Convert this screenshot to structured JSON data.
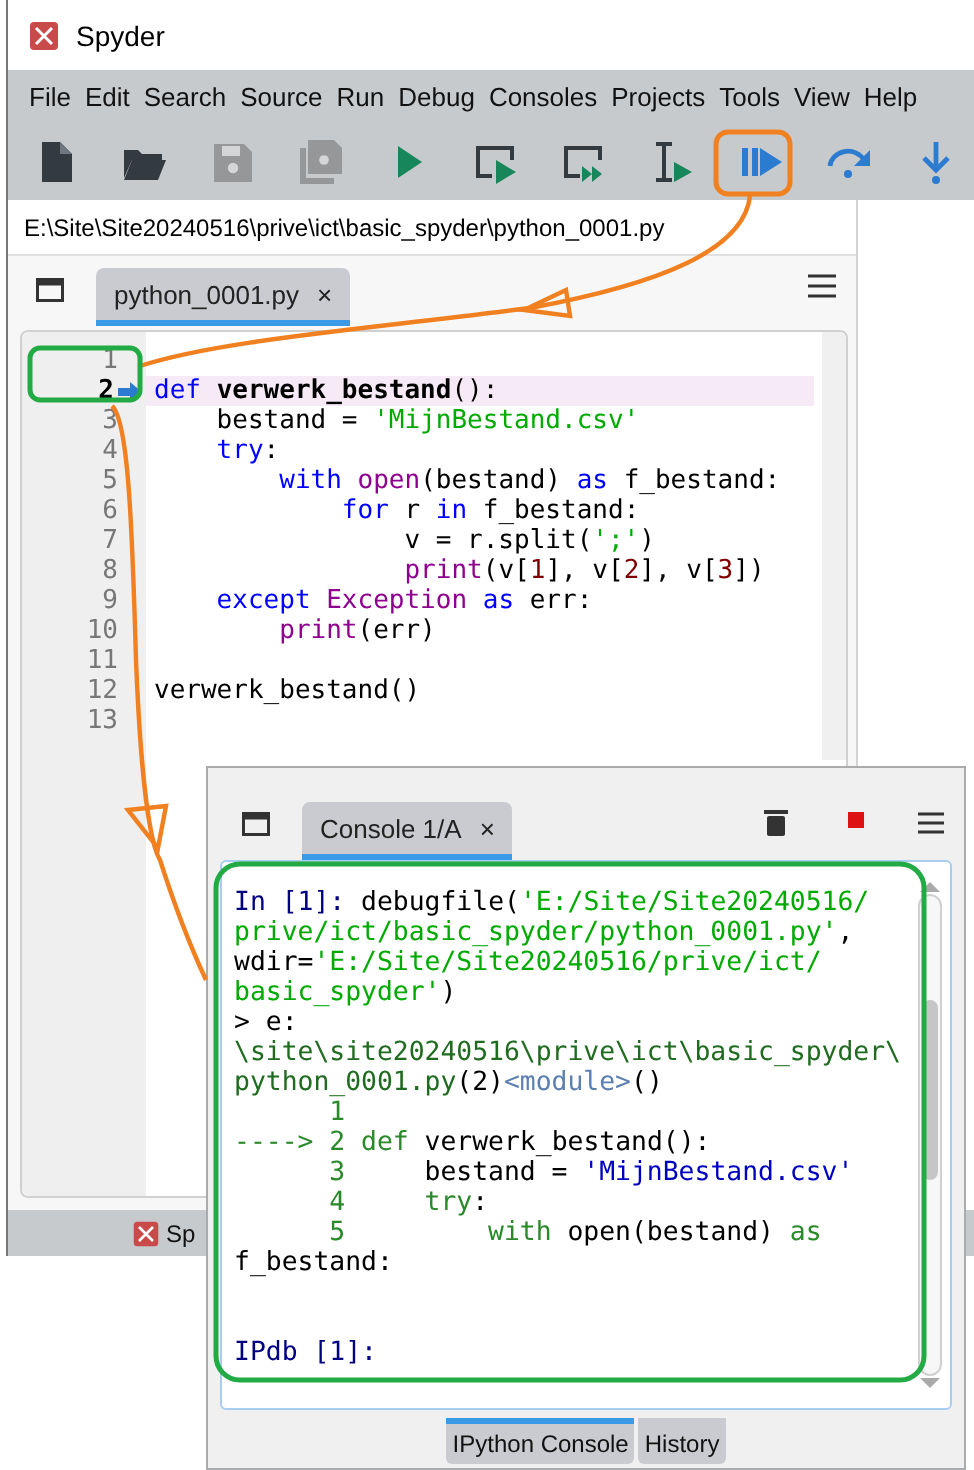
{
  "window": {
    "title": "Spyder"
  },
  "menu": [
    "File",
    "Edit",
    "Search",
    "Source",
    "Run",
    "Debug",
    "Consoles",
    "Projects",
    "Tools",
    "View",
    "Help"
  ],
  "toolbar": [
    {
      "kind": "new-file",
      "disabled": false
    },
    {
      "kind": "open",
      "disabled": false
    },
    {
      "kind": "save",
      "disabled": true
    },
    {
      "kind": "save-all",
      "disabled": true
    },
    {
      "kind": "run",
      "disabled": false
    },
    {
      "kind": "run-cell",
      "disabled": false
    },
    {
      "kind": "run-cell-advance",
      "disabled": false
    },
    {
      "kind": "run-selection",
      "disabled": false
    },
    {
      "kind": "debug",
      "disabled": false
    },
    {
      "kind": "step-over",
      "disabled": false
    },
    {
      "kind": "step-into",
      "disabled": false
    }
  ],
  "path": "E:\\Site\\Site20240516\\prive\\ict\\basic_spyder\\python_0001.py",
  "editor": {
    "tabs": [
      {
        "label": "python_0001.py",
        "close": "×",
        "selected": true
      }
    ],
    "lines": [
      {
        "number": "1",
        "current": false
      },
      {
        "number": "2",
        "current": true,
        "tokens": [
          {
            "kind": "keyword",
            "text": "def "
          },
          {
            "kind": "defname",
            "text": "verwerk_bestand"
          },
          {
            "kind": "plain",
            "text": "():"
          }
        ]
      },
      {
        "number": "3",
        "current": false,
        "tokens": [
          {
            "kind": "plain",
            "text": "    bestand = "
          },
          {
            "kind": "string",
            "text": "'MijnBestand.csv'"
          }
        ]
      },
      {
        "number": "4",
        "current": false,
        "tokens": [
          {
            "kind": "keyword",
            "text": "    try"
          },
          {
            "kind": "plain",
            "text": ":"
          }
        ]
      },
      {
        "number": "5",
        "current": false,
        "tokens": [
          {
            "kind": "keyword",
            "text": "        with "
          },
          {
            "kind": "builtin",
            "text": "open"
          },
          {
            "kind": "plain",
            "text": "(bestand) "
          },
          {
            "kind": "keyword",
            "text": "as"
          },
          {
            "kind": "plain",
            "text": " f_bestand:"
          }
        ]
      },
      {
        "number": "6",
        "current": false,
        "tokens": [
          {
            "kind": "keyword",
            "text": "            for"
          },
          {
            "kind": "plain",
            "text": " r "
          },
          {
            "kind": "keyword",
            "text": "in"
          },
          {
            "kind": "plain",
            "text": " f_bestand:"
          }
        ]
      },
      {
        "number": "7",
        "current": false,
        "tokens": [
          {
            "kind": "plain",
            "text": "                v = r.split("
          },
          {
            "kind": "string",
            "text": "';'"
          },
          {
            "kind": "plain",
            "text": ")"
          }
        ]
      },
      {
        "number": "8",
        "current": false,
        "tokens": [
          {
            "kind": "builtin",
            "text": "                print"
          },
          {
            "kind": "plain",
            "text": "(v["
          },
          {
            "kind": "number",
            "text": "1"
          },
          {
            "kind": "plain",
            "text": "], v["
          },
          {
            "kind": "number",
            "text": "2"
          },
          {
            "kind": "plain",
            "text": "], v["
          },
          {
            "kind": "number",
            "text": "3"
          },
          {
            "kind": "plain",
            "text": "])"
          }
        ]
      },
      {
        "number": "9",
        "current": false,
        "tokens": [
          {
            "kind": "keyword",
            "text": "    except "
          },
          {
            "kind": "builtin",
            "text": "Exception "
          },
          {
            "kind": "keyword",
            "text": "as"
          },
          {
            "kind": "plain",
            "text": " err:"
          }
        ]
      },
      {
        "number": "10",
        "current": false,
        "tokens": [
          {
            "kind": "builtin",
            "text": "        print"
          },
          {
            "kind": "plain",
            "text": "(err)"
          }
        ]
      },
      {
        "number": "11",
        "current": false
      },
      {
        "number": "12",
        "current": false,
        "tokens": [
          {
            "kind": "plain",
            "text": "verwerk_bestand()"
          }
        ]
      },
      {
        "number": "13",
        "current": false
      }
    ]
  },
  "status_bar": {
    "text": "Sp"
  },
  "console": {
    "tabs": [
      {
        "label": "Console 1/A",
        "close": "×",
        "selected": true
      }
    ],
    "output": [
      [
        {
          "kind": "prompt",
          "text": "In ["
        },
        {
          "kind": "prompt_num",
          "text": "1"
        },
        {
          "kind": "prompt",
          "text": "]: "
        },
        {
          "kind": "plain",
          "text": "debugfile("
        },
        {
          "kind": "string",
          "text": "'E:/Site/Site20240516/"
        }
      ],
      [
        {
          "kind": "string",
          "text": "prive/ict/basic_spyder/python_0001.py'"
        },
        {
          "kind": "plain",
          "text": ","
        }
      ],
      [
        {
          "kind": "plain",
          "text": "wdir="
        },
        {
          "kind": "string",
          "text": "'E:/Site/Site20240516/prive/ict/"
        }
      ],
      [
        {
          "kind": "string",
          "text": "basic_spyder'"
        },
        {
          "kind": "plain",
          "text": ")"
        }
      ],
      [
        {
          "kind": "plain",
          "text": "> e:"
        }
      ],
      [
        {
          "kind": "path",
          "text": "\\site\\site20240516\\prive\\ict\\basic_spyder\\"
        }
      ],
      [
        {
          "kind": "path",
          "text": "python_0001.py"
        },
        {
          "kind": "plain",
          "text": "(2)"
        },
        {
          "kind": "module",
          "text": "<module>"
        },
        {
          "kind": "plain",
          "text": "()"
        }
      ],
      [
        {
          "kind": "lineno",
          "text": "      1"
        }
      ],
      [
        {
          "kind": "lineno",
          "text": "----> 2 "
        },
        {
          "kind": "keyword",
          "text": "def"
        },
        {
          "kind": "plain",
          "text": " verwerk_bestand():"
        }
      ],
      [
        {
          "kind": "lineno",
          "text": "      3"
        },
        {
          "kind": "plain",
          "text": "     bestand = "
        },
        {
          "kind": "cstring",
          "text": "'MijnBestand.csv'"
        }
      ],
      [
        {
          "kind": "lineno",
          "text": "      4"
        },
        {
          "kind": "keyword",
          "text": "     try"
        },
        {
          "kind": "plain",
          "text": ":"
        }
      ],
      [
        {
          "kind": "lineno",
          "text": "      5"
        },
        {
          "kind": "keyword",
          "text": "         with"
        },
        {
          "kind": "plain",
          "text": " open(bestand) "
        },
        {
          "kind": "keyword",
          "text": "as"
        }
      ],
      [
        {
          "kind": "plain",
          "text": "f_bestand:"
        }
      ]
    ],
    "prompt": "IPdb [1]:",
    "bottom_tabs": [
      {
        "label": "IPython Console",
        "selected": true
      },
      {
        "label": "History",
        "selected": false
      }
    ]
  }
}
